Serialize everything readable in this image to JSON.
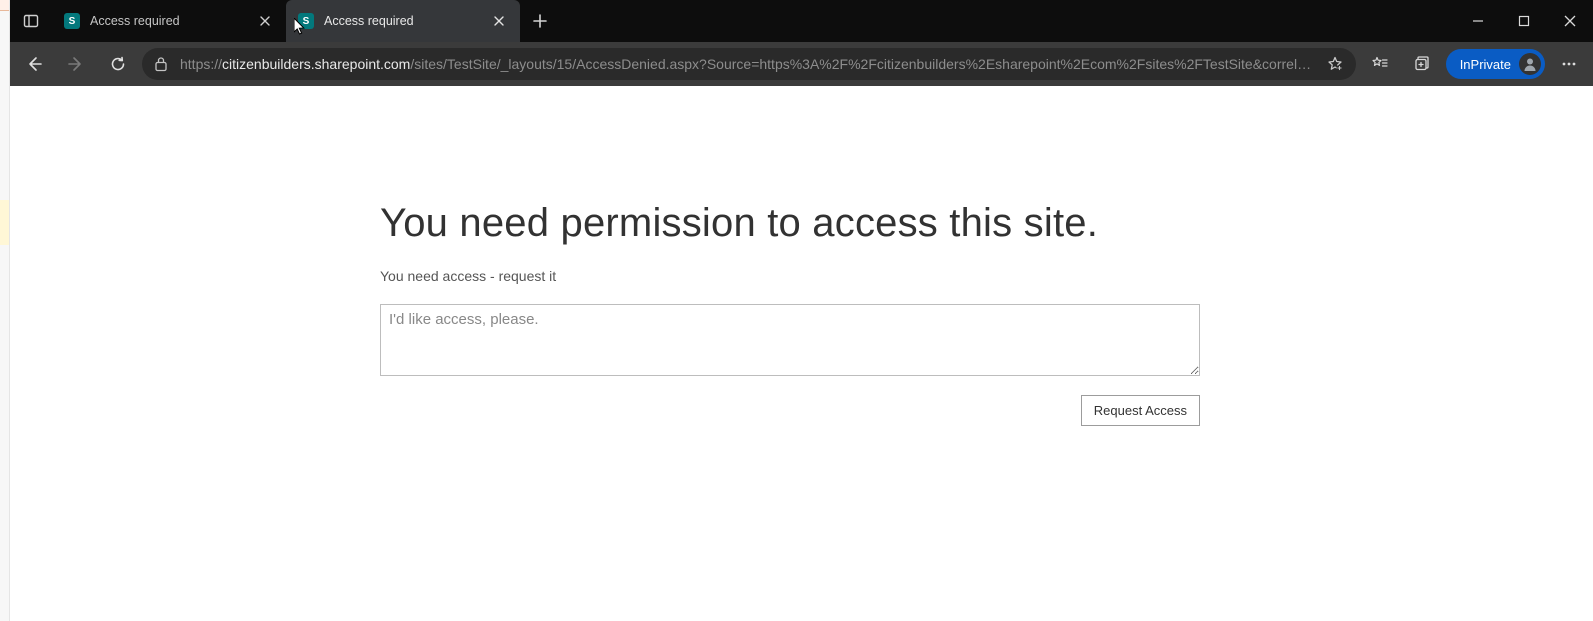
{
  "tabs": [
    {
      "title": "Access required",
      "favicon_letter": "S",
      "active": false
    },
    {
      "title": "Access required",
      "favicon_letter": "S",
      "active": true
    }
  ],
  "address": {
    "scheme": "https://",
    "host": "citizenbuilders.sharepoint.com",
    "path": "/sites/TestSite/_layouts/15/AccessDenied.aspx?Source=https%3A%2F%2Fcitizenbuilders%2Esharepoint%2Ecom%2Fsites%2FTestSite&correl…"
  },
  "profile": {
    "label": "InPrivate"
  },
  "page": {
    "heading": "You need permission to access this site.",
    "subtext": "You need access - request it",
    "textarea_placeholder": "I'd like access, please.",
    "textarea_value": "",
    "request_button": "Request Access"
  }
}
